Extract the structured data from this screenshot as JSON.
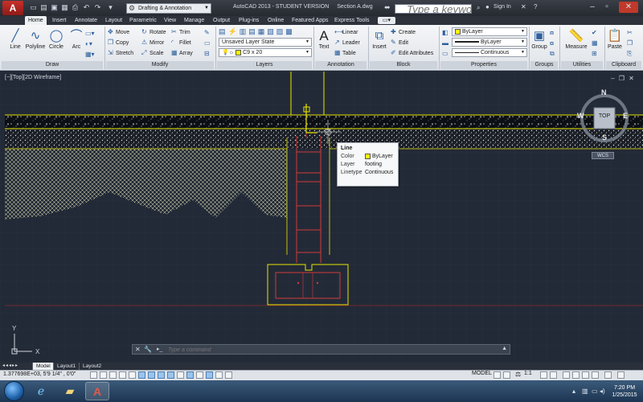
{
  "titlebar": {
    "app_logo": "A",
    "workspace": "Drafting & Annotation",
    "title": "AutoCAD 2013 - STUDENT VERSION",
    "filename": "Section A.dwg",
    "search_placeholder": "Type a keyword or phrase",
    "sign_in": "Sign In"
  },
  "tabs": [
    "Home",
    "Insert",
    "Annotate",
    "Layout",
    "Parametric",
    "View",
    "Manage",
    "Output",
    "Plug-ins",
    "Online",
    "Featured Apps",
    "Express Tools"
  ],
  "active_tab": "Home",
  "ribbon": {
    "draw": {
      "title": "Draw",
      "line": "Line",
      "polyline": "Polyline",
      "circle": "Circle",
      "arc": "Arc"
    },
    "modify": {
      "title": "Modify",
      "move": "Move",
      "rotate": "Rotate",
      "trim": "Trim",
      "copy": "Copy",
      "mirror": "Mirror",
      "fillet": "Fillet",
      "stretch": "Stretch",
      "scale": "Scale",
      "array": "Array"
    },
    "layers": {
      "title": "Layers",
      "layer_state": "Unsaved Layer State",
      "current_layer": "C9 x 20"
    },
    "annotation": {
      "title": "Annotation",
      "text": "Text",
      "linear": "Linear",
      "leader": "Leader",
      "table": "Table"
    },
    "block": {
      "title": "Block",
      "insert": "Insert",
      "create": "Create",
      "edit": "Edit",
      "edit_attributes": "Edit Attributes"
    },
    "properties": {
      "title": "Properties",
      "color": "ByLayer",
      "lineweight": "ByLayer",
      "linetype": "Continuous"
    },
    "groups": {
      "title": "Groups",
      "group": "Group"
    },
    "utilities": {
      "title": "Utilities",
      "measure": "Measure"
    },
    "clipboard": {
      "title": "Clipboard",
      "paste": "Paste"
    }
  },
  "viewport": {
    "label": "[−][Top][2D Wireframe]",
    "viewcube": {
      "north": "N",
      "south": "S",
      "east": "E",
      "west": "W",
      "face": "TOP",
      "ucs": "WCS"
    },
    "ucs_x": "X",
    "ucs_y": "Y"
  },
  "tooltip": {
    "title": "Line",
    "rows": [
      {
        "key": "Color",
        "value": "ByLayer"
      },
      {
        "key": "Layer",
        "value": "footing"
      },
      {
        "key": "Linetype",
        "value": "Continuous"
      }
    ]
  },
  "command": {
    "placeholder": "Type a command"
  },
  "layout_tabs": [
    "Model",
    "Layout1",
    "Layout2"
  ],
  "status": {
    "coordinates": "1.377698E+03, 5'9 1/4\" , 0'0\"",
    "model": "MODEL",
    "scale": "1:1"
  },
  "clock": {
    "time": "7:20 PM",
    "date": "1/25/2015"
  },
  "colors": {
    "accent": "#2c5f9e",
    "drawing_bg": "#232a37",
    "yellow_line": "#e6e600",
    "red_line": "#d23a3a"
  }
}
